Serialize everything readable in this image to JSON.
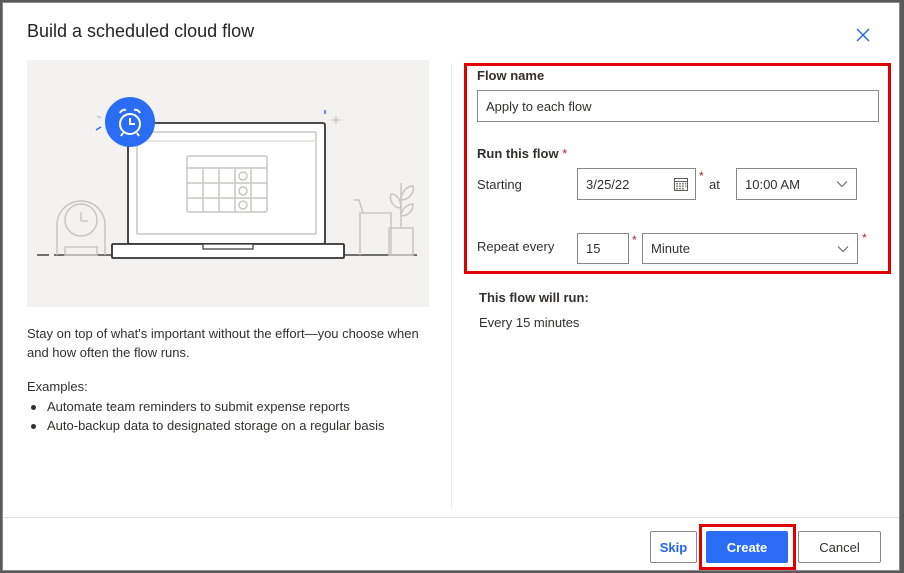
{
  "dialog": {
    "title": "Build a scheduled cloud flow",
    "close_icon": "close-icon"
  },
  "left_panel": {
    "illustration": "laptop-calendar-alarm-clock-illustration",
    "description": "Stay on top of what's important without the effort—you choose when and how often the flow runs.",
    "examples_label": "Examples:",
    "examples": [
      "Automate team reminders to submit expense reports",
      "Auto-backup data to designated storage on a regular basis"
    ]
  },
  "form": {
    "flow_name_label": "Flow name",
    "flow_name_value": "Apply to each flow",
    "run_label": "Run this flow",
    "required_mark": "*",
    "starting_label": "Starting",
    "start_date": "3/25/22",
    "at_label": "at",
    "start_time": "10:00 AM",
    "repeat_label": "Repeat every",
    "repeat_interval": "15",
    "repeat_unit": "Minute"
  },
  "summary": {
    "title": "This flow will run:",
    "text": "Every 15 minutes"
  },
  "footer": {
    "skip_label": "Skip",
    "create_label": "Create",
    "cancel_label": "Cancel"
  },
  "colors": {
    "accent": "#2b6cf5",
    "highlight": "#e00000",
    "required": "#a4262c"
  }
}
